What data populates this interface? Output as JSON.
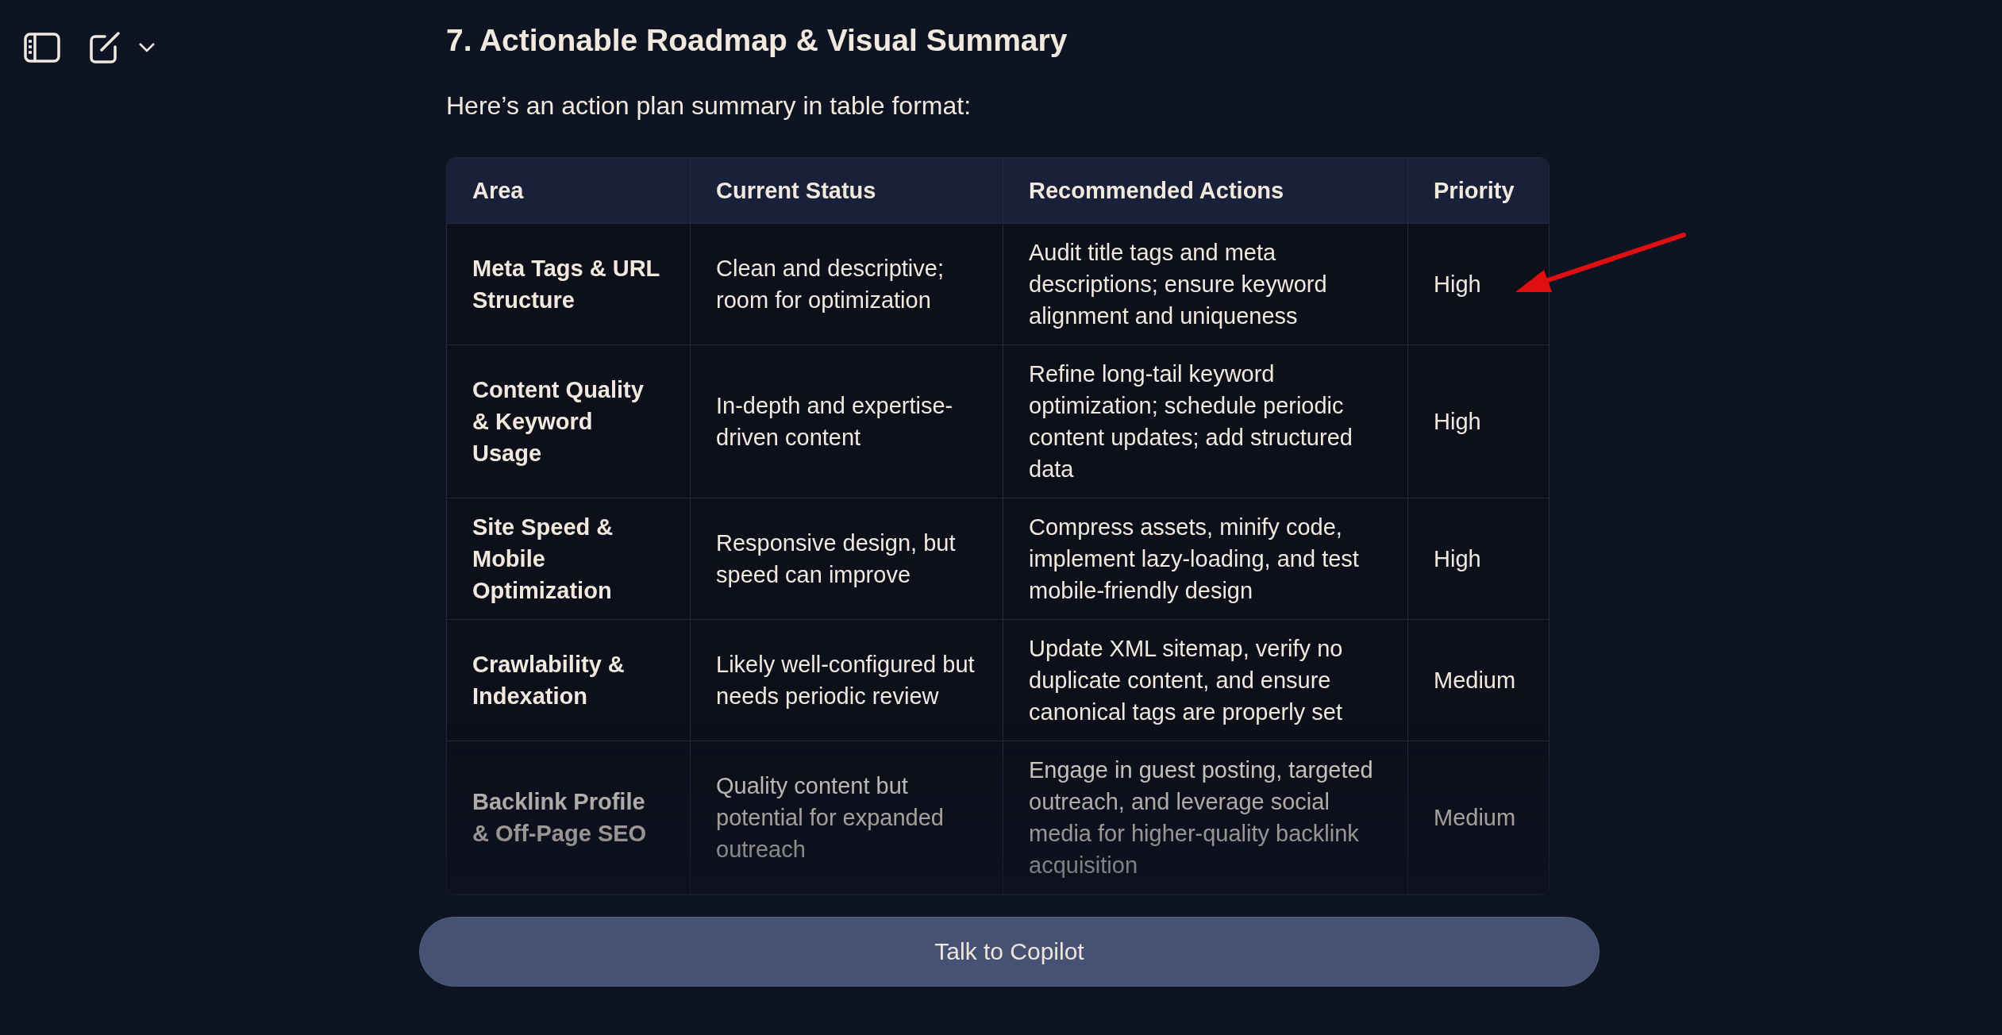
{
  "heading": "7. Actionable Roadmap & Visual Summary",
  "intro": "Here’s an action plan summary in table format:",
  "table": {
    "columns": [
      "Area",
      "Current Status",
      "Recommended Actions",
      "Priority"
    ],
    "rows": [
      {
        "area": "Meta Tags & URL Structure",
        "status": "Clean and descriptive; room for optimization",
        "actions": "Audit title tags and meta descriptions; ensure keyword alignment and uniqueness",
        "priority": "High"
      },
      {
        "area": "Content Quality & Keyword Usage",
        "status": "In-depth and expertise-driven content",
        "actions": "Refine long-tail keyword optimization; schedule periodic content updates; add structured data",
        "priority": "High"
      },
      {
        "area": "Site Speed & Mobile Optimization",
        "status": "Responsive design, but speed can improve",
        "actions": "Compress assets, minify code, implement lazy-loading, and test mobile-friendly design",
        "priority": "High"
      },
      {
        "area": "Crawlability & Indexation",
        "status": "Likely well-configured but needs periodic review",
        "actions": "Update XML sitemap, verify no duplicate content, and ensure canonical tags are properly set",
        "priority": "Medium"
      },
      {
        "area": "Backlink Profile & Off-Page SEO",
        "status": "Quality content but potential for expanded outreach",
        "actions": "Engage in guest posting, targeted outreach, and leverage social media for higher-quality backlink acquisition",
        "priority": "Medium"
      }
    ]
  },
  "annotation": {
    "kind": "arrow",
    "color": "#e01010"
  },
  "chat_button": "Talk to Copilot"
}
